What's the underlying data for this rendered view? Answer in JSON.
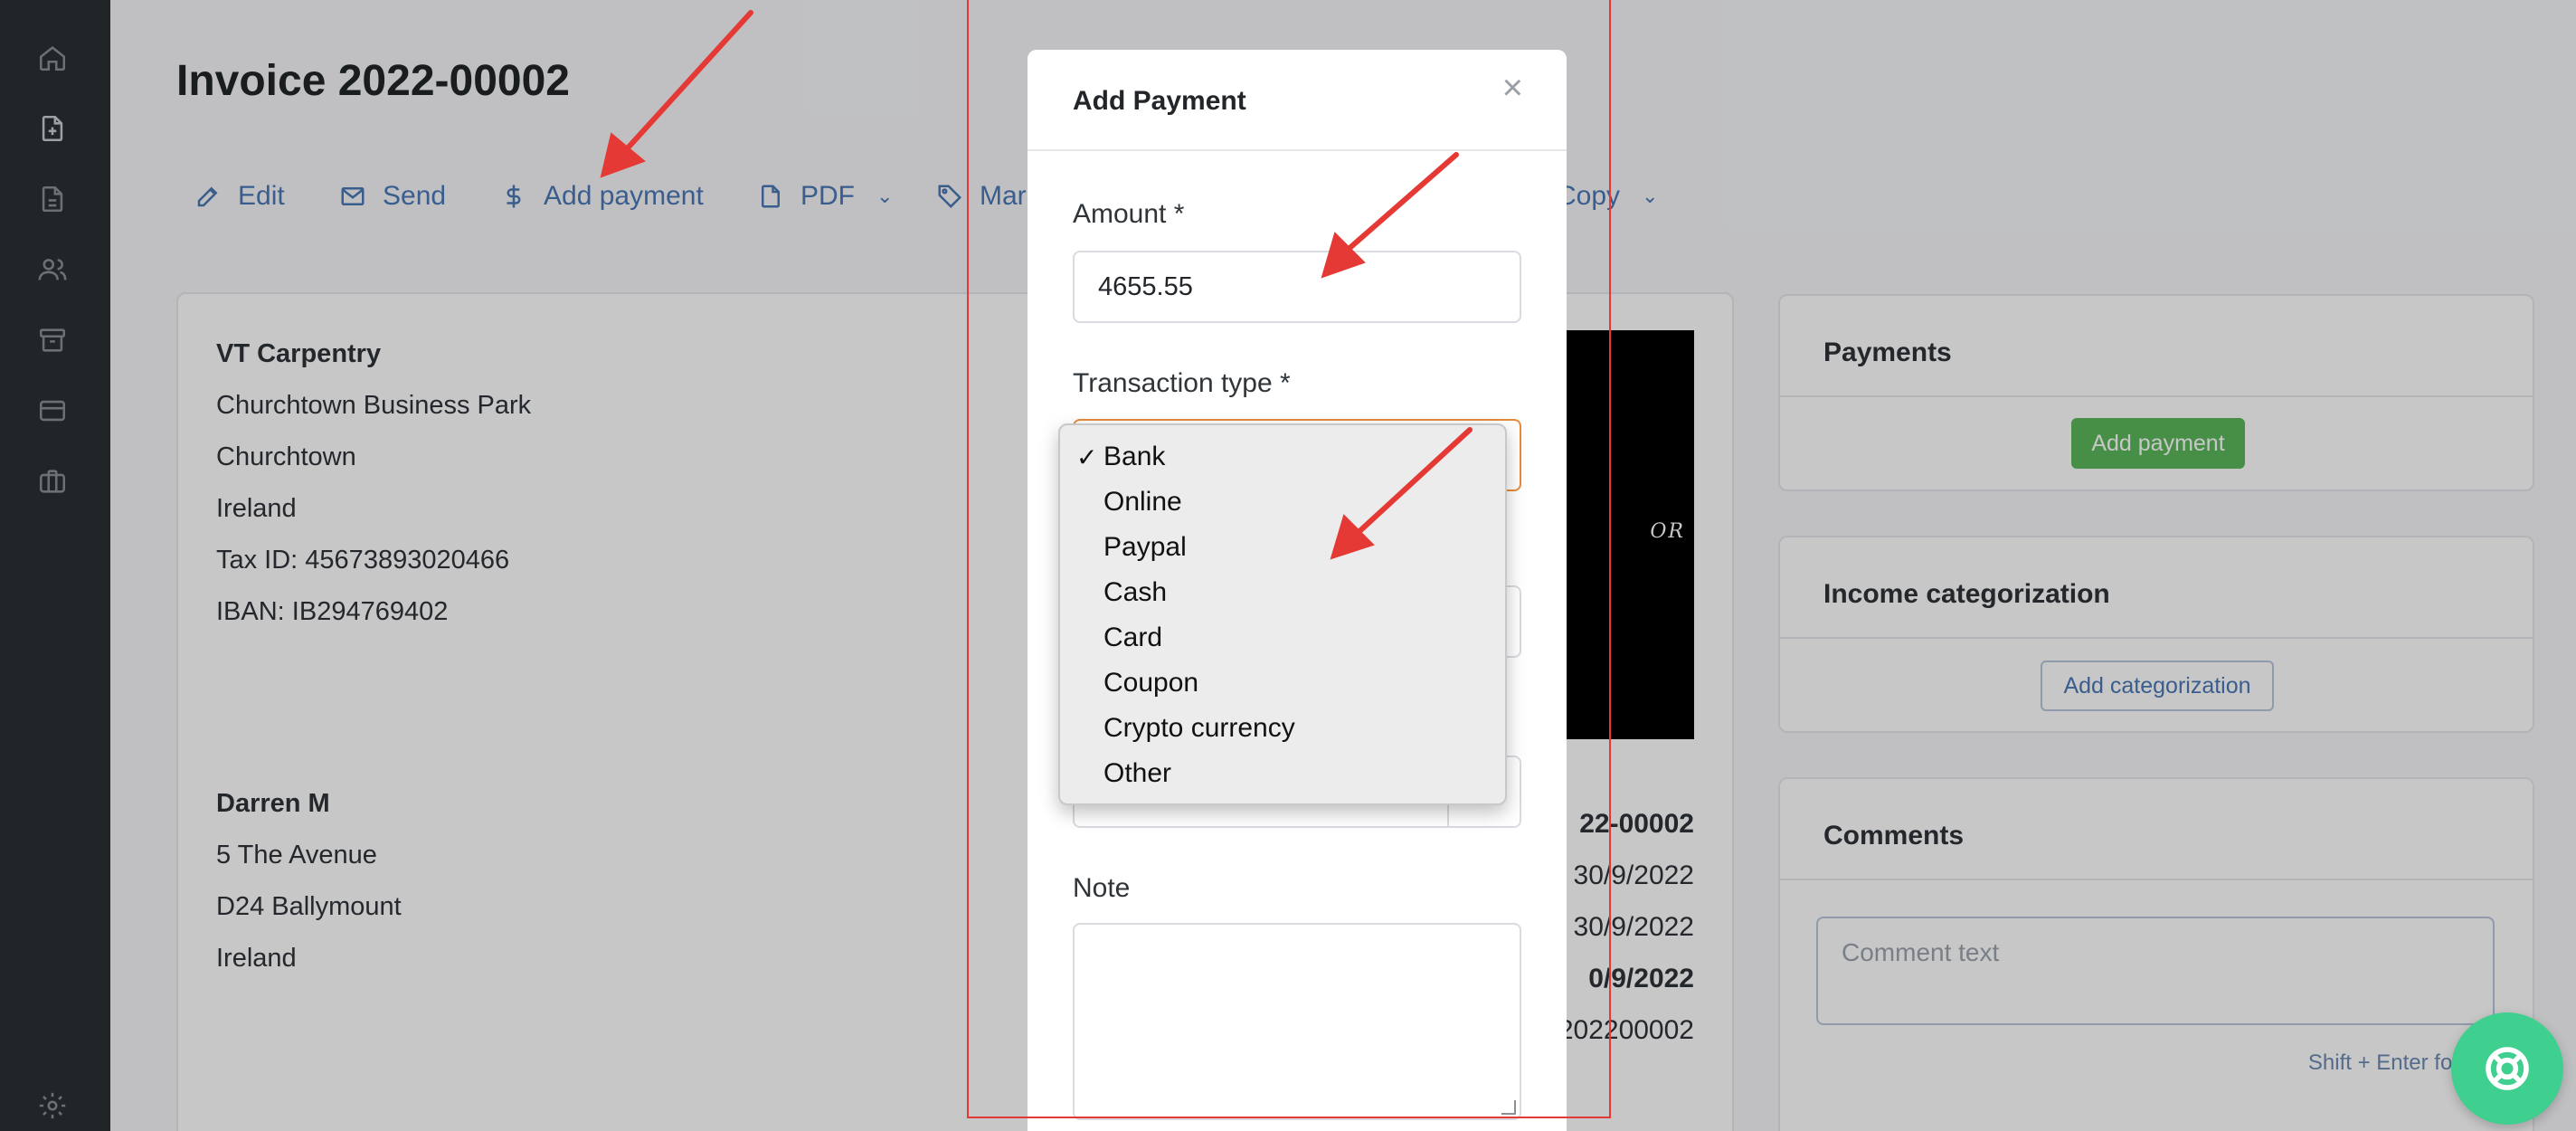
{
  "sidebar": {
    "icons": [
      "home-icon",
      "invoice-icon",
      "document-icon",
      "users-icon",
      "archive-icon",
      "card-icon",
      "briefcase-icon",
      "settings-icon"
    ]
  },
  "page": {
    "title": "Invoice 2022-00002"
  },
  "toolbar": {
    "edit": "Edit",
    "send": "Send",
    "add_payment": "Add payment",
    "pdf": "PDF",
    "mark": "Mar",
    "copy": "Copy"
  },
  "seller": {
    "name": "VT Carpentry",
    "line1": "Churchtown Business Park",
    "line2": "Churchtown",
    "line3": "Ireland",
    "tax": "Tax ID: 45673893020466",
    "iban": "IBAN: IB294769402"
  },
  "buyer": {
    "name": "Darren M",
    "line1": "5 The Avenue",
    "line2": "D24 Ballymount",
    "line3": "Ireland"
  },
  "logo": {
    "text": "OR"
  },
  "invoice_meta": {
    "number": "22-00002",
    "date1": "30/9/2022",
    "date2": "30/9/2022",
    "due": "0/9/2022",
    "ref": "202200002"
  },
  "payments_card": {
    "title": "Payments",
    "button": "Add payment"
  },
  "income_card": {
    "title": "Income categorization",
    "button": "Add categorization"
  },
  "comments_card": {
    "title": "Comments",
    "placeholder": "Comment text",
    "hint": "Shift + Enter for new"
  },
  "modal": {
    "title": "Add Payment",
    "close": "×",
    "amount_label": "Amount *",
    "amount_value": "4655.55",
    "type_label": "Transaction type *",
    "note_label": "Note"
  },
  "dropdown": {
    "selected": "Bank",
    "options": [
      "Bank",
      "Online",
      "Paypal",
      "Cash",
      "Card",
      "Coupon",
      "Crypto currency",
      "Other"
    ]
  },
  "colors": {
    "sidebar": "#2c3034",
    "link": "#4a78b5",
    "green": "#5cb85c",
    "focus": "#e98a3b",
    "annotation": "#e53935"
  }
}
